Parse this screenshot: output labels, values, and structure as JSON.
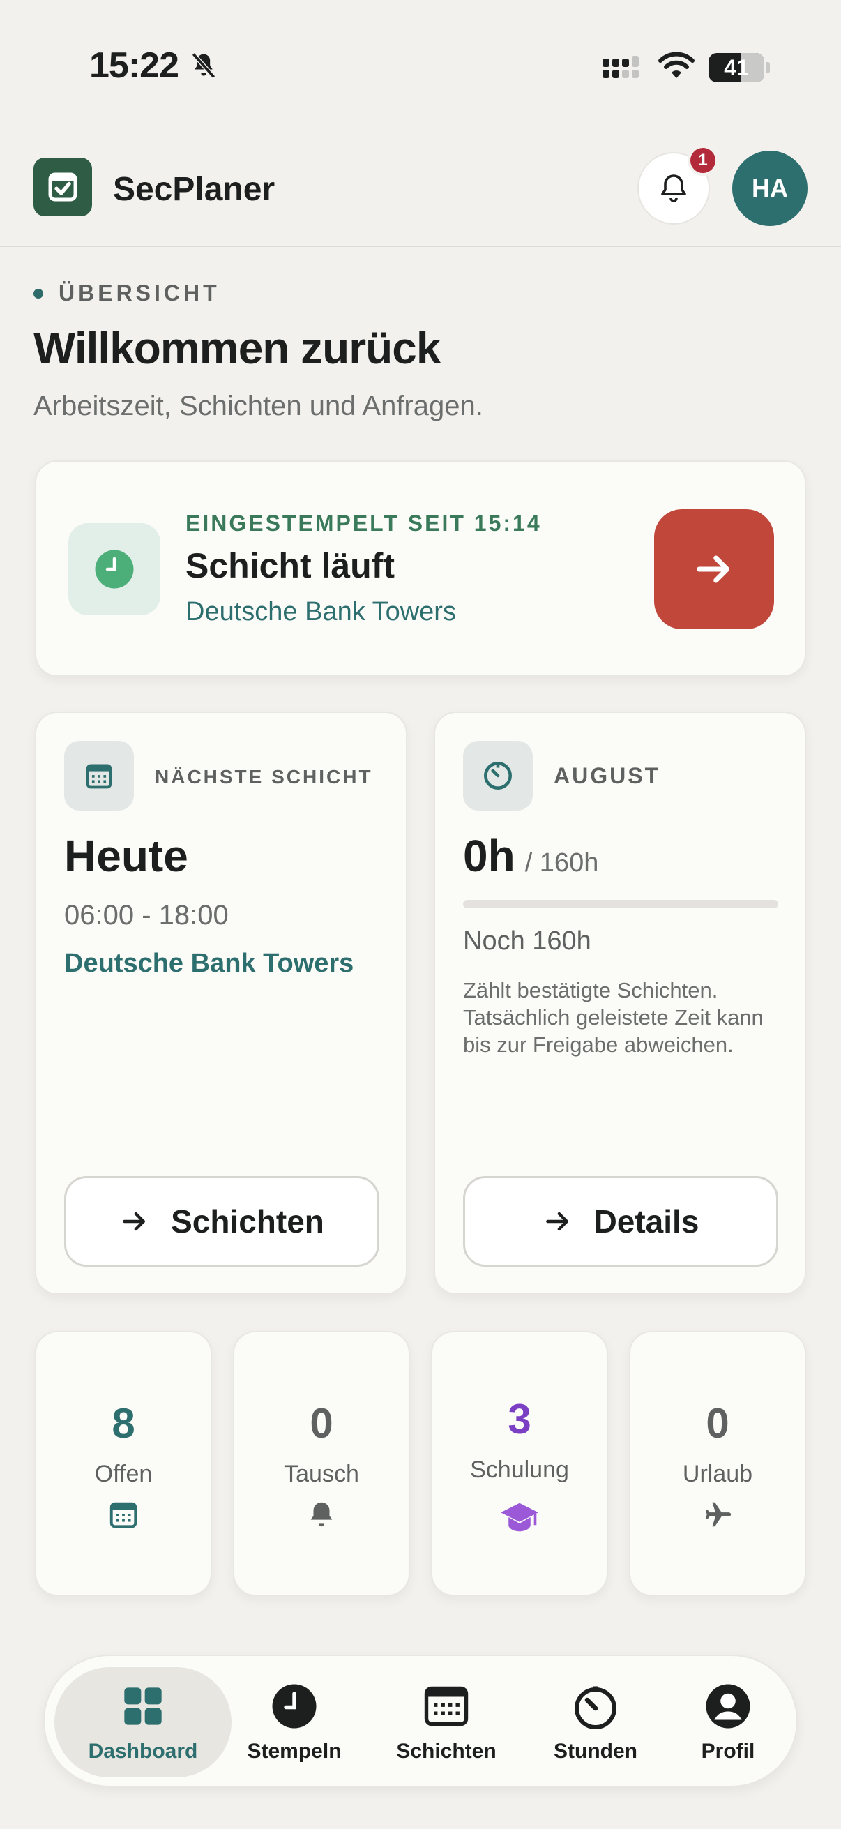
{
  "status_bar": {
    "time": "15:22",
    "battery": "41"
  },
  "header": {
    "title": "SecPlaner",
    "notification_count": "1",
    "avatar_initials": "HA"
  },
  "intro": {
    "kicker": "ÜBERSICHT",
    "title": "Willkommen zurück",
    "subtitle": "Arbeitszeit, Schichten und Anfragen."
  },
  "clock_card": {
    "kicker": "EINGESTEMPELT SEIT 15:14",
    "title": "Schicht läuft",
    "location": "Deutsche Bank Towers",
    "status_color": "#4caf7a",
    "action_color": "#c0473a"
  },
  "next_shift": {
    "kicker": "NÄCHSTE SCHICHT",
    "day": "Heute",
    "time": "06:00 - 18:00",
    "location": "Deutsche Bank Towers",
    "button_label": "Schichten"
  },
  "hours": {
    "kicker": "AUGUST",
    "worked": "0h",
    "target": "/ 160h",
    "progress_fraction": 0,
    "remaining": "Noch 160h",
    "note": "Zählt bestätigte Schichten. Tatsächlich geleistete Zeit kann bis zur Freigabe abwei­chen.",
    "button_label": "Details"
  },
  "stats": [
    {
      "value": "8",
      "label": "Offen",
      "icon": "calendar-icon",
      "color": "#2d6e6e"
    },
    {
      "value": "0",
      "label": "Tausch",
      "icon": "bell-icon",
      "color": "#5e615f"
    },
    {
      "value": "3",
      "label": "Schulung",
      "icon": "graduation-cap-icon",
      "color": "#7b3fc4"
    },
    {
      "value": "0",
      "label": "Urlaub",
      "icon": "airplane-icon",
      "color": "#5e615f"
    }
  ],
  "nav": {
    "items": [
      {
        "label": "Dashboard",
        "icon": "dashboard-grid-icon",
        "active": true
      },
      {
        "label": "Stempeln",
        "icon": "clock-icon",
        "active": false
      },
      {
        "label": "Schichten",
        "icon": "calendar-icon",
        "active": false
      },
      {
        "label": "Stunden",
        "icon": "timer-icon",
        "active": false
      },
      {
        "label": "Profil",
        "icon": "profile-icon",
        "active": false
      }
    ]
  },
  "colors": {
    "accent": "#2d6e6e",
    "brand": "#2e5c45",
    "background": "#f2f1ed",
    "badge": "#b32a3a"
  }
}
